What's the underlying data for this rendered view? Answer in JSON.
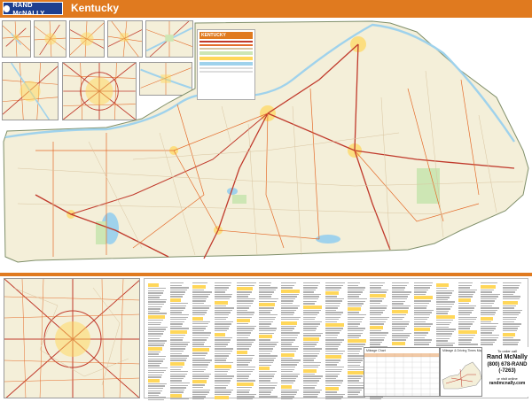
{
  "header": {
    "brand": "RAND McNALLY",
    "title": "Kentucky"
  },
  "legend": {
    "title": "KENTUCKY"
  },
  "mileage": {
    "table_title": "Mileage Chart",
    "map_title": "Mileage & Driving Times Map"
  },
  "order": {
    "call_text": "To order call",
    "brand": "Rand McNally",
    "phone": "(800) 678-RAND",
    "phone_alt": "(-7263)",
    "visit_text": "or visit online",
    "url": "randmcnally.com"
  },
  "colors": {
    "accent": "#e07a1f",
    "brand_blue": "#1d3f8f",
    "land": "#f4efd9",
    "water": "#9fd2ec",
    "interstate": "#c0392b",
    "highway": "#e46b2a",
    "park": "#cde6b4",
    "urban": "#ffd75a"
  }
}
